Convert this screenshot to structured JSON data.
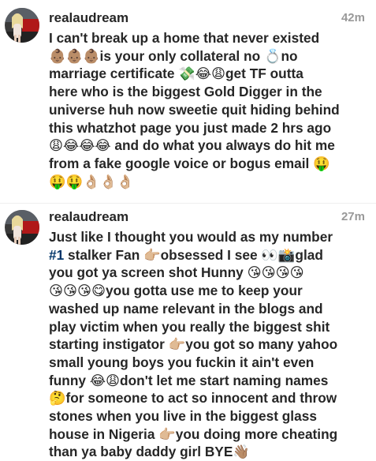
{
  "comments": [
    {
      "username": "realaudream",
      "timestamp": "42m",
      "lines": [
        "I can't break up a home that never existed",
        "👶🏽👶🏽👶🏽is your only collateral no 💍no",
        "marriage certificate 💸😂😩get TF outta",
        "here who is the biggest Gold Digger in the",
        "universe huh now sweetie quit hiding behind",
        "this whatzhot page you just made 2 hrs ago",
        "😩😂😂😂 and do what you always do hit me",
        "from a fake google voice or bogus email 🤑",
        "🤑🤑👌🏼👌🏼👌🏼"
      ]
    },
    {
      "username": "realaudream",
      "timestamp": "27m",
      "lines": [
        "Just like I thought you would as my number",
        "#1 stalker Fan 👉🏼obsessed I see 👀📸glad",
        "you got ya screen shot Hunny 😘😘😘😘",
        "😘😘😘😋you gotta use me to keep your",
        "washed up name relevant in the blogs and",
        "play victim when you really the biggest shit",
        "starting instigator 👉🏼you got so many yahoo",
        "small young boys you fuckin it ain't even",
        "funny 😂😩don't let me start naming names",
        "🤔for someone  to act so innocent and throw",
        "stones when you live in the biggest glass",
        "house in Nigeria 👉🏼you doing more cheating",
        "than ya baby daddy girl BYE👋🏽"
      ]
    }
  ]
}
